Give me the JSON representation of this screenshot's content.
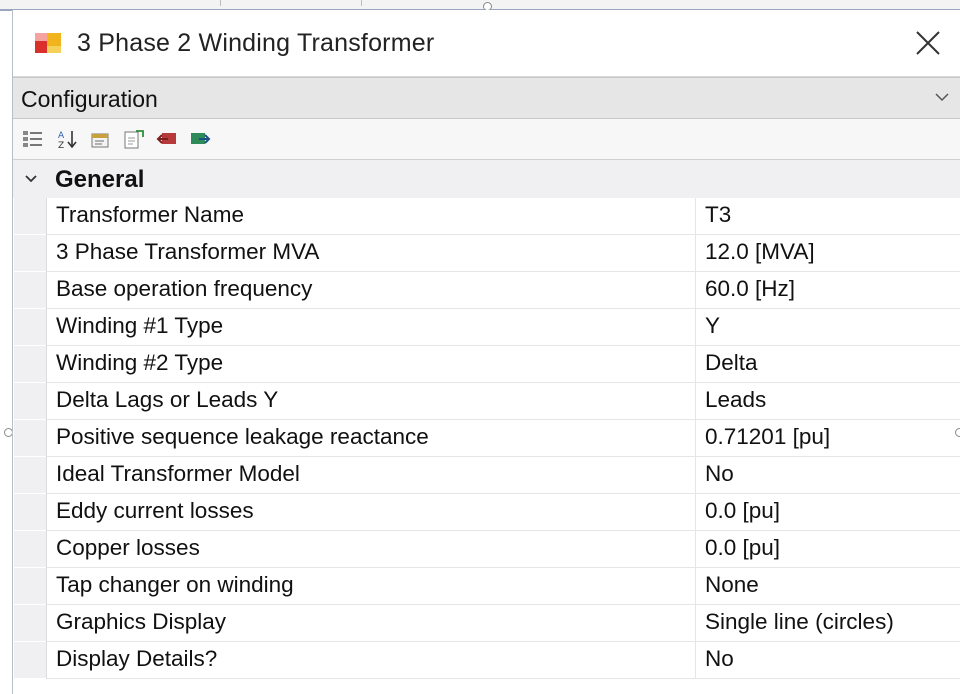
{
  "window": {
    "title": "3 Phase 2 Winding Transformer",
    "icons": {
      "app": "component-icon",
      "close": "close-icon"
    }
  },
  "category": {
    "selected": "Configuration",
    "icon": "chevron-down-icon"
  },
  "toolbar": {
    "buttons": [
      {
        "name": "categorized-view-icon"
      },
      {
        "name": "alphabetical-sort-icon"
      },
      {
        "name": "property-pages-icon"
      },
      {
        "name": "export-icon"
      },
      {
        "name": "import-icon"
      },
      {
        "name": "apply-icon"
      }
    ]
  },
  "group": {
    "name": "General",
    "expanded": true,
    "rows": [
      {
        "name": "Transformer Name",
        "value": "T3"
      },
      {
        "name": "3 Phase Transformer MVA",
        "value": "12.0 [MVA]"
      },
      {
        "name": "Base operation frequency",
        "value": "60.0 [Hz]"
      },
      {
        "name": "Winding #1 Type",
        "value": "Y"
      },
      {
        "name": "Winding #2 Type",
        "value": "Delta"
      },
      {
        "name": "Delta Lags or Leads Y",
        "value": "Leads"
      },
      {
        "name": "Positive sequence leakage reactance",
        "value": "0.71201 [pu]"
      },
      {
        "name": "Ideal Transformer Model",
        "value": "No"
      },
      {
        "name": "Eddy current losses",
        "value": "0.0 [pu]"
      },
      {
        "name": "Copper losses",
        "value": "0.0 [pu]"
      },
      {
        "name": "Tap changer on winding",
        "value": "None"
      },
      {
        "name": "Graphics Display",
        "value": "Single line (circles)"
      },
      {
        "name": "Display Details?",
        "value": "No"
      }
    ]
  },
  "colors": {
    "header_bg": "#e6e6e6",
    "group_bg": "#f0f0f3",
    "accent_red": "#d9302c",
    "accent_yellow": "#f2b41c"
  }
}
